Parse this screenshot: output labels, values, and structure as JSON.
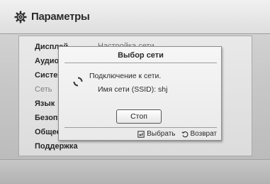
{
  "window": {
    "title": "Параметры",
    "icon": "gear-icon"
  },
  "menu": {
    "items": [
      {
        "label": "Дисплей",
        "state": "normal"
      },
      {
        "label": "Аудио",
        "state": "normal"
      },
      {
        "label": "Система",
        "state": "normal"
      },
      {
        "label": "Сеть",
        "state": "selected"
      },
      {
        "label": "Язык",
        "state": "normal"
      },
      {
        "label": "Безопас",
        "state": "normal"
      },
      {
        "label": "Общее",
        "state": "normal"
      },
      {
        "label": "Поддержка",
        "state": "normal"
      }
    ]
  },
  "content": {
    "header": "Настройка сети"
  },
  "dialog": {
    "title": "Выбор сети",
    "status": "Подключение к сети.",
    "ssid": "Имя сети (SSID): shj",
    "stop_label": "Стоп",
    "footer": {
      "select_label": "Выбрать",
      "select_icon": "enter-icon",
      "back_label": "Возврат",
      "back_icon": "return-icon"
    }
  },
  "colors": {
    "background": "#c9c9c9",
    "text": "#2a2a2a",
    "dim_text": "#7f7f7f"
  }
}
